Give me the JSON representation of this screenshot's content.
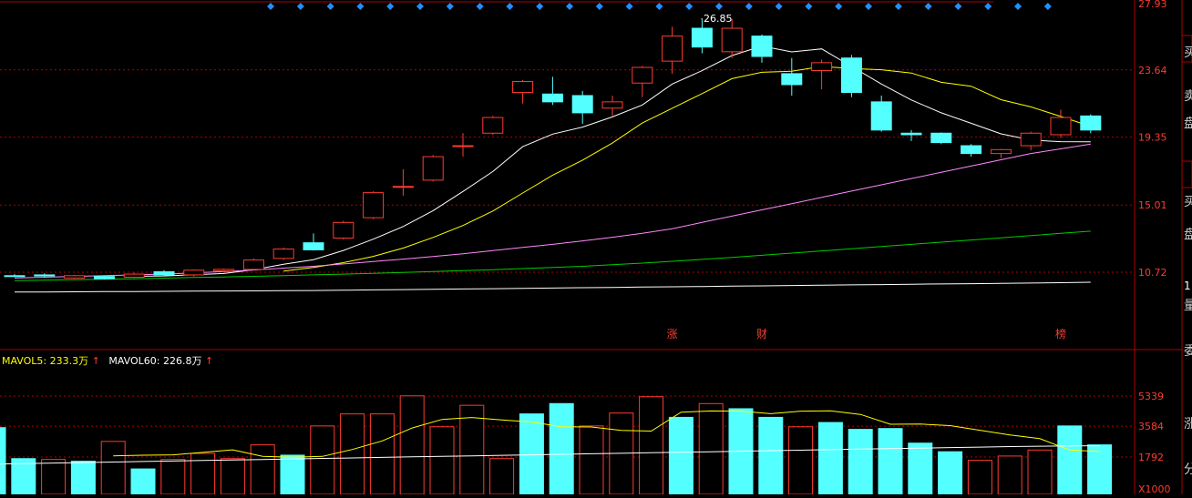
{
  "price_axis": {
    "ticks": [
      "27.93",
      "23.64",
      "19.35",
      "15.01",
      "10.72"
    ],
    "tick_values": [
      27.93,
      23.64,
      19.35,
      15.01,
      10.72
    ]
  },
  "volume_axis": {
    "ticks": [
      "5339",
      "3584",
      "1792"
    ],
    "tick_values": [
      5339,
      3584,
      1792
    ],
    "unit_label": "X1000"
  },
  "max_price_label": "26.85",
  "volume_legend": [
    {
      "text": "MAVOL5: 233.3万",
      "arrow": "↑",
      "color": "#ffff00"
    },
    {
      "text": "MAVOL60: 226.8万",
      "arrow": "↑",
      "color": "#ffffff"
    }
  ],
  "event_markers": [
    {
      "index": 22,
      "label": "涨"
    },
    {
      "index": 25,
      "label": "财"
    },
    {
      "index": 35,
      "label": "榜"
    }
  ],
  "right_panel_glyphs": [
    "买",
    "卖",
    "盘",
    "买",
    "盘",
    "1",
    "量",
    "委",
    "涨",
    "分"
  ],
  "colors": {
    "up": "#ff3b30",
    "down": "#54ffff",
    "ma5": "#ffffff",
    "ma10": "#ffff00",
    "ma20": "#ff88ff",
    "ma60": "#00cc00",
    "ma120": "#ffffff",
    "grid": "#b00000",
    "axis_text": "#ff3b30",
    "markers": "#1e90ff"
  },
  "chart_data": [
    {
      "type": "candlestick",
      "candles": [
        {
          "open": 10.5,
          "high": 10.6,
          "low": 10.4,
          "close": 10.45
        },
        {
          "open": 10.55,
          "high": 10.65,
          "low": 10.42,
          "close": 10.48
        },
        {
          "open": 10.35,
          "high": 10.55,
          "low": 10.3,
          "close": 10.5
        },
        {
          "open": 10.45,
          "high": 10.5,
          "low": 10.25,
          "close": 10.3
        },
        {
          "open": 10.4,
          "high": 10.7,
          "low": 10.35,
          "close": 10.6
        },
        {
          "open": 10.75,
          "high": 10.85,
          "low": 10.5,
          "close": 10.55
        },
        {
          "open": 10.55,
          "high": 10.9,
          "low": 10.45,
          "close": 10.85
        },
        {
          "open": 10.8,
          "high": 10.95,
          "low": 10.7,
          "close": 10.9
        },
        {
          "open": 10.9,
          "high": 11.6,
          "low": 10.85,
          "close": 11.5
        },
        {
          "open": 11.6,
          "high": 12.3,
          "low": 11.5,
          "close": 12.2
        },
        {
          "open": 12.6,
          "high": 13.2,
          "low": 12.1,
          "close": 12.15
        },
        {
          "open": 12.9,
          "high": 14.0,
          "low": 12.8,
          "close": 13.9
        },
        {
          "open": 14.2,
          "high": 15.9,
          "low": 14.1,
          "close": 15.8
        },
        {
          "open": 16.2,
          "high": 17.3,
          "low": 15.6,
          "close": 16.2
        },
        {
          "open": 16.6,
          "high": 18.2,
          "low": 16.5,
          "close": 18.1
        },
        {
          "open": 18.75,
          "high": 19.6,
          "low": 18.1,
          "close": 18.8
        },
        {
          "open": 19.6,
          "high": 20.7,
          "low": 19.5,
          "close": 20.6
        },
        {
          "open": 22.2,
          "high": 23.0,
          "low": 21.5,
          "close": 22.9
        },
        {
          "open": 22.1,
          "high": 23.2,
          "low": 21.4,
          "close": 21.6
        },
        {
          "open": 22.0,
          "high": 22.3,
          "low": 20.2,
          "close": 20.9
        },
        {
          "open": 21.2,
          "high": 22.0,
          "low": 20.7,
          "close": 21.6
        },
        {
          "open": 22.8,
          "high": 23.9,
          "low": 21.9,
          "close": 23.8
        },
        {
          "open": 24.2,
          "high": 26.4,
          "low": 23.4,
          "close": 25.8
        },
        {
          "open": 26.3,
          "high": 26.85,
          "low": 24.7,
          "close": 25.1
        },
        {
          "open": 24.8,
          "high": 26.9,
          "low": 24.4,
          "close": 26.3
        },
        {
          "open": 25.8,
          "high": 25.9,
          "low": 24.1,
          "close": 24.5
        },
        {
          "open": 23.4,
          "high": 24.4,
          "low": 22.0,
          "close": 22.7
        },
        {
          "open": 23.6,
          "high": 24.3,
          "low": 22.4,
          "close": 24.1
        },
        {
          "open": 24.4,
          "high": 24.6,
          "low": 21.9,
          "close": 22.2
        },
        {
          "open": 21.6,
          "high": 22.0,
          "low": 19.7,
          "close": 19.8
        },
        {
          "open": 19.6,
          "high": 19.8,
          "low": 19.1,
          "close": 19.5
        },
        {
          "open": 19.6,
          "high": 19.65,
          "low": 18.9,
          "close": 19.0
        },
        {
          "open": 18.8,
          "high": 18.9,
          "low": 18.1,
          "close": 18.3
        },
        {
          "open": 18.3,
          "high": 18.6,
          "low": 18.0,
          "close": 18.55
        },
        {
          "open": 18.8,
          "high": 19.7,
          "low": 18.5,
          "close": 19.6
        },
        {
          "open": 19.5,
          "high": 21.1,
          "low": 19.3,
          "close": 20.6
        },
        {
          "open": 20.7,
          "high": 20.8,
          "low": 19.6,
          "close": 19.8
        }
      ],
      "moving_averages": [
        {
          "name": "MA5",
          "values": [
            null,
            null,
            null,
            null,
            10.46,
            10.48,
            10.56,
            10.64,
            10.88,
            11.23,
            11.52,
            12.11,
            12.83,
            13.64,
            14.65,
            15.88,
            17.15,
            18.74,
            19.54,
            19.99,
            20.64,
            21.4,
            22.74,
            23.59,
            24.56,
            25.16,
            24.79,
            24.98,
            23.86,
            22.74,
            21.72,
            20.9,
            20.23,
            19.56,
            19.16,
            19.06,
            19.05
          ]
        },
        {
          "name": "MA10",
          "values": [
            null,
            null,
            null,
            null,
            null,
            null,
            null,
            null,
            null,
            10.79,
            11.03,
            11.33,
            11.73,
            12.26,
            12.94,
            13.7,
            14.63,
            15.78,
            16.92,
            17.88,
            18.97,
            20.25,
            21.19,
            22.13,
            23.08,
            23.49,
            23.55,
            23.86,
            23.73,
            23.65,
            23.44,
            22.85,
            22.6,
            21.74,
            21.28,
            20.67,
            20.03
          ]
        },
        {
          "name": "MA20",
          "values": [
            10.35,
            10.4,
            10.45,
            10.5,
            10.55,
            10.6,
            10.68,
            10.76,
            10.86,
            10.98,
            11.1,
            11.25,
            11.4,
            11.56,
            11.72,
            11.9,
            12.1,
            12.3,
            12.5,
            12.72,
            12.95,
            13.2,
            13.5,
            13.9,
            14.3,
            14.7,
            15.1,
            15.5,
            15.9,
            16.3,
            16.7,
            17.1,
            17.5,
            17.9,
            18.3,
            18.6,
            18.9
          ]
        },
        {
          "name": "MA60",
          "values": [
            10.18,
            10.21,
            10.24,
            10.27,
            10.3,
            10.34,
            10.38,
            10.42,
            10.46,
            10.5,
            10.55,
            10.6,
            10.65,
            10.7,
            10.76,
            10.82,
            10.88,
            10.95,
            11.02,
            11.1,
            11.2,
            11.3,
            11.42,
            11.54,
            11.66,
            11.8,
            11.94,
            12.08,
            12.22,
            12.36,
            12.5,
            12.64,
            12.78,
            12.92,
            13.06,
            13.2,
            13.34
          ]
        },
        {
          "name": "MA120",
          "values": [
            9.45,
            9.46,
            9.47,
            9.48,
            9.49,
            9.5,
            9.51,
            9.52,
            9.53,
            9.54,
            9.55,
            9.57,
            9.59,
            9.61,
            9.63,
            9.65,
            9.67,
            9.69,
            9.71,
            9.73,
            9.75,
            9.77,
            9.79,
            9.81,
            9.83,
            9.85,
            9.87,
            9.89,
            9.91,
            9.93,
            9.95,
            9.97,
            9.99,
            10.01,
            10.03,
            10.05,
            10.08
          ]
        }
      ]
    },
    {
      "type": "bar",
      "title": "volume",
      "values": [
        3500,
        1700,
        1650,
        1550,
        2700,
        1100,
        1650,
        2000,
        1700,
        2500,
        1900,
        3600,
        4300,
        4300,
        5350,
        3550,
        4800,
        1700,
        4300,
        4900,
        3600,
        4350,
        5300,
        4100,
        4900,
        4600,
        4100,
        3550,
        3800,
        3400,
        3450,
        2600,
        2100,
        1600,
        1850,
        2200,
        3600,
        2500
      ],
      "ma_series": [
        {
          "name": "MAVOL5",
          "values": [
            null,
            null,
            null,
            null,
            1860,
            1900,
            1920,
            2060,
            2210,
            1830,
            1780,
            1830,
            2230,
            2730,
            3480,
            3980,
            4090,
            3950,
            3830,
            3550,
            3540,
            3340,
            3300,
            4400,
            4470,
            4460,
            4310,
            4460,
            4480,
            4270,
            3700,
            3710,
            3620,
            3350,
            3080,
            2860,
            2200,
            2110
          ]
        },
        {
          "name": "MAVOL60",
          "values": [
            1380,
            1410,
            1440,
            1470,
            1500,
            1530,
            1560,
            1590,
            1620,
            1650,
            1680,
            1710,
            1740,
            1770,
            1800,
            1830,
            1860,
            1890,
            1920,
            1950,
            1980,
            2010,
            2040,
            2070,
            2100,
            2130,
            2160,
            2190,
            2220,
            2250,
            2280,
            2310,
            2340,
            2370,
            2400,
            2420,
            2440,
            2450
          ]
        }
      ]
    }
  ]
}
